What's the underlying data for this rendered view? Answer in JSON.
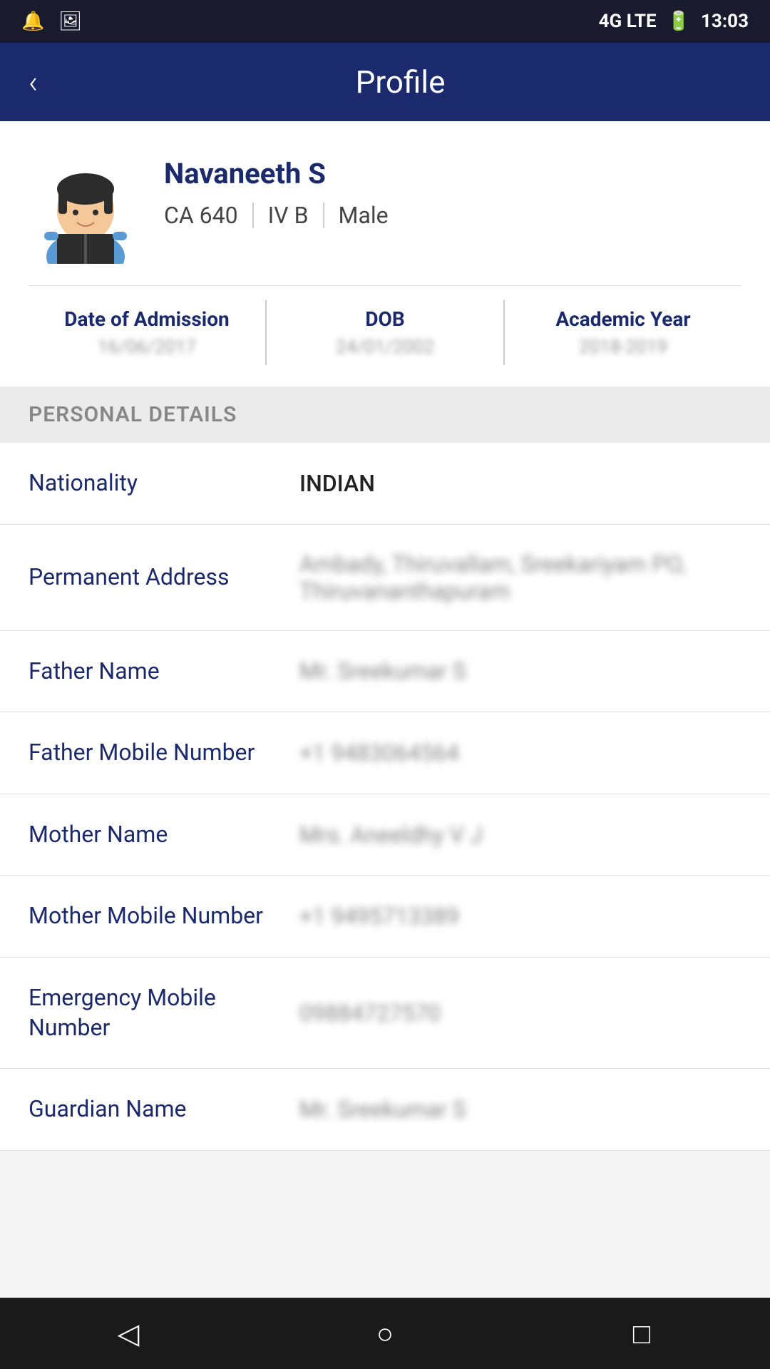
{
  "status_bar": {
    "time": "13:03",
    "network": "4G LTE"
  },
  "header": {
    "title": "Profile",
    "back_label": "‹"
  },
  "profile": {
    "name": "Navaneeth S",
    "roll_number": "CA 640",
    "section": "IV B",
    "gender": "Male",
    "avatar_alt": "Student Avatar"
  },
  "profile_stats": {
    "date_of_admission_label": "Date of Admission",
    "date_of_admission_value": "16/06/2017",
    "dob_label": "DOB",
    "dob_value": "24/01/2002",
    "academic_year_label": "Academic Year",
    "academic_year_value": "2018-2019"
  },
  "personal_details_section": {
    "title": "PERSONAL DETAILS"
  },
  "personal_details": [
    {
      "label": "Nationality",
      "value": "INDIAN",
      "blurred": false
    },
    {
      "label": "Permanent Address",
      "value": "Ambady, Thiruvallam, Sreekariyam PO, Thiruvananthapuram",
      "blurred": true
    },
    {
      "label": "Father Name",
      "value": "Mr. Sreekumar S",
      "blurred": true
    },
    {
      "label": "Father Mobile Number",
      "value": "+1 9483064564",
      "blurred": true
    },
    {
      "label": "Mother Name",
      "value": "Mrs. Aneeldhy V J",
      "blurred": true
    },
    {
      "label": "Mother Mobile Number",
      "value": "+1 9495713389",
      "blurred": true
    },
    {
      "label": "Emergency Mobile Number",
      "value": "09884727570",
      "blurred": true
    },
    {
      "label": "Guardian Name",
      "value": "Mr. Sreekumar S",
      "blurred": true
    }
  ],
  "bottom_nav": {
    "back_icon": "◁",
    "home_icon": "○",
    "recent_icon": "□"
  }
}
